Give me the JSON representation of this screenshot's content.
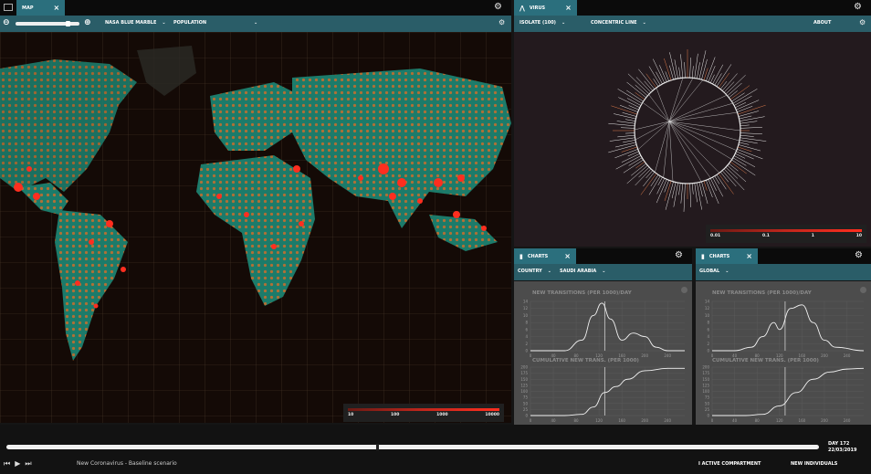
{
  "map_panel": {
    "tab_label": "MAP",
    "zoom_value": 0.85,
    "layer_select": "NASA BLUE MARBLE",
    "metric_select": "POPULATION",
    "legend_labels": [
      "10",
      "100",
      "1000",
      "10000"
    ]
  },
  "virus_panel": {
    "tab_label": "VIRUS",
    "select_one": "ISOLATE (100)",
    "select_two": "CONCENTRIC LINE",
    "about_label": "ABOUT",
    "legend_labels": [
      "0.01",
      "0.1",
      "1",
      "10"
    ]
  },
  "charts_left": {
    "tab_label": "CHARTS",
    "scope_select": "COUNTRY",
    "country_select": "SAUDI ARABIA",
    "top_title": "NEW TRANSITIONS (PER 1000)/DAY",
    "bottom_title": "CUMULATIVE NEW TRANS. (PER 1000)",
    "chart_data": [
      {
        "type": "line",
        "title": "NEW TRANSITIONS (PER 1000)/DAY",
        "x": [
          0,
          30,
          60,
          90,
          110,
          125,
          140,
          160,
          180,
          200,
          220,
          240,
          270
        ],
        "values": [
          0,
          0,
          0,
          3,
          10,
          13.5,
          9,
          3,
          5,
          4,
          1,
          0,
          0
        ],
        "x_ticks": [
          "0",
          "40",
          "80",
          "120",
          "160",
          "200",
          "240"
        ],
        "y_ticks": [
          "0",
          "2",
          "4",
          "6",
          "8",
          "10",
          "12",
          "14"
        ],
        "xlim": [
          0,
          270
        ],
        "ylim": [
          0,
          14
        ]
      },
      {
        "type": "line",
        "title": "CUMULATIVE NEW TRANS. (PER 1000)",
        "x": [
          0,
          60,
          90,
          110,
          130,
          150,
          170,
          200,
          240,
          270
        ],
        "values": [
          0,
          0,
          5,
          35,
          95,
          120,
          150,
          185,
          195,
          195
        ],
        "x_ticks": [
          "0",
          "40",
          "80",
          "120",
          "160",
          "200",
          "240"
        ],
        "y_ticks": [
          "0",
          "25",
          "50",
          "75",
          "100",
          "125",
          "150",
          "175",
          "200"
        ],
        "xlim": [
          0,
          270
        ],
        "ylim": [
          0,
          200
        ]
      }
    ]
  },
  "charts_right": {
    "tab_label": "CHARTS",
    "scope_select": "GLOBAL",
    "top_title": "NEW TRANSITIONS (PER 1000)/DAY",
    "bottom_title": "CUMULATIVE NEW TRANS. (PER 1000)",
    "chart_data": [
      {
        "type": "line",
        "title": "NEW TRANSITIONS (PER 1000)/DAY",
        "x": [
          0,
          40,
          70,
          90,
          110,
          120,
          140,
          160,
          180,
          200,
          220,
          270
        ],
        "values": [
          0,
          0,
          1,
          4,
          8,
          6,
          12,
          13,
          8,
          3,
          1,
          0
        ],
        "x_ticks": [
          "0",
          "40",
          "80",
          "120",
          "160",
          "200",
          "240"
        ],
        "y_ticks": [
          "0",
          "2",
          "4",
          "6",
          "8",
          "10",
          "12",
          "14"
        ],
        "xlim": [
          0,
          270
        ],
        "ylim": [
          0,
          14
        ]
      },
      {
        "type": "line",
        "title": "CUMULATIVE NEW TRANS. (PER 1000)",
        "x": [
          0,
          60,
          90,
          120,
          150,
          180,
          210,
          240,
          270
        ],
        "values": [
          0,
          0,
          5,
          40,
          95,
          150,
          180,
          192,
          195
        ],
        "x_ticks": [
          "0",
          "40",
          "80",
          "120",
          "160",
          "200",
          "240"
        ],
        "y_ticks": [
          "0",
          "25",
          "50",
          "75",
          "100",
          "125",
          "150",
          "175",
          "200"
        ],
        "xlim": [
          0,
          270
        ],
        "ylim": [
          0,
          200
        ]
      }
    ]
  },
  "timeline": {
    "progress": 0.455,
    "day_label": "DAY 172",
    "date_label": "22/03/2019"
  },
  "footer": {
    "scenario_label": "New Coronavirus - Baseline scenario",
    "compartment_label": "I ACTIVE COMPARTMENT",
    "individuals_label": "NEW INDIVIDUALS"
  },
  "colors": {
    "accent_teal": "#2b6f7d",
    "toolbar_teal": "#2a5d68",
    "hotspot_red": "#ff2e1f",
    "land_teal": "#1f8a78"
  }
}
